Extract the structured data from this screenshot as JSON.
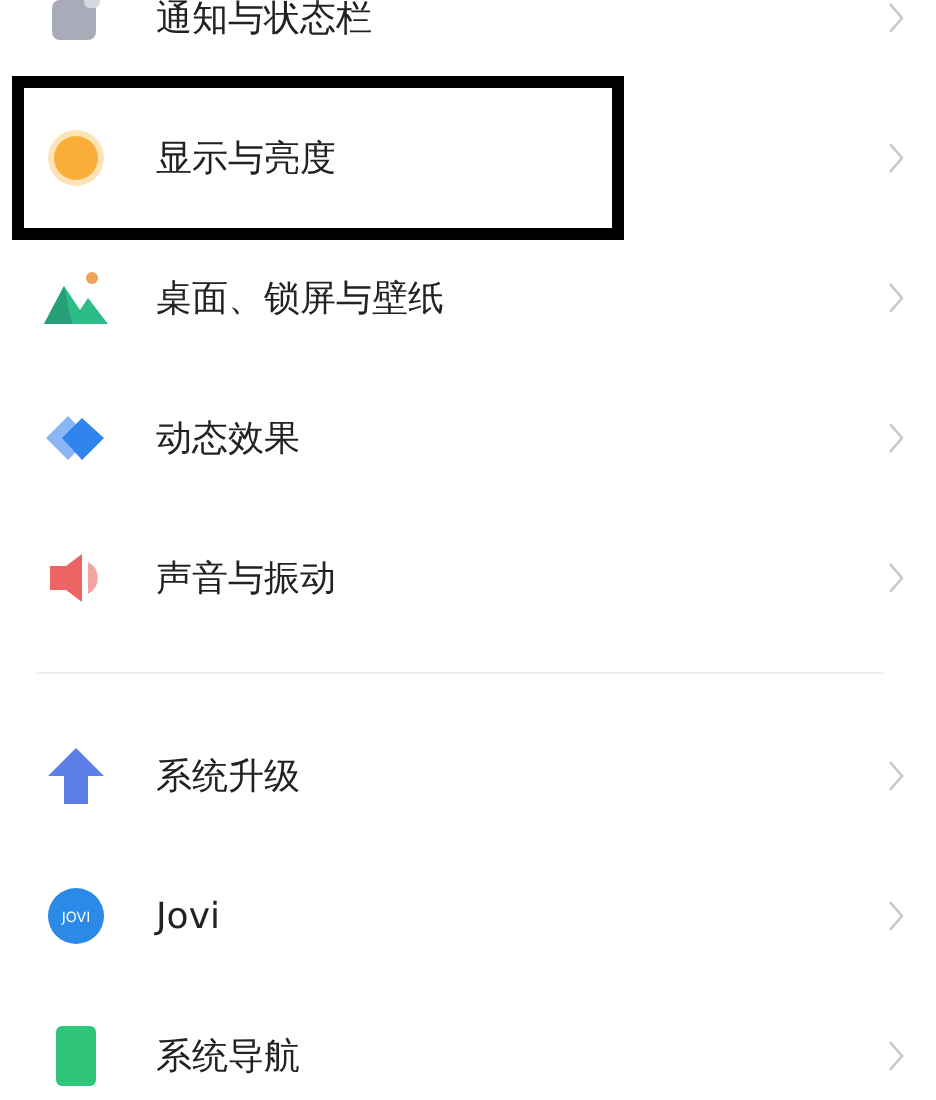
{
  "groups": [
    {
      "items": [
        {
          "label": "通知与状态栏",
          "kind": "notification",
          "highlighted": false
        },
        {
          "label": "显示与亮度",
          "kind": "sun",
          "highlighted": true
        },
        {
          "label": "桌面、锁屏与壁纸",
          "kind": "landscape",
          "highlighted": false
        },
        {
          "label": "动态效果",
          "kind": "diamonds",
          "highlighted": false
        },
        {
          "label": "声音与振动",
          "kind": "speaker",
          "highlighted": false
        }
      ]
    },
    {
      "items": [
        {
          "label": "系统升级",
          "kind": "arrow",
          "highlighted": false
        },
        {
          "label": "Jovi",
          "kind": "jovi",
          "icon_label": "JOVI",
          "highlighted": false
        },
        {
          "label": "系统导航",
          "kind": "nav",
          "highlighted": false
        }
      ]
    }
  ]
}
